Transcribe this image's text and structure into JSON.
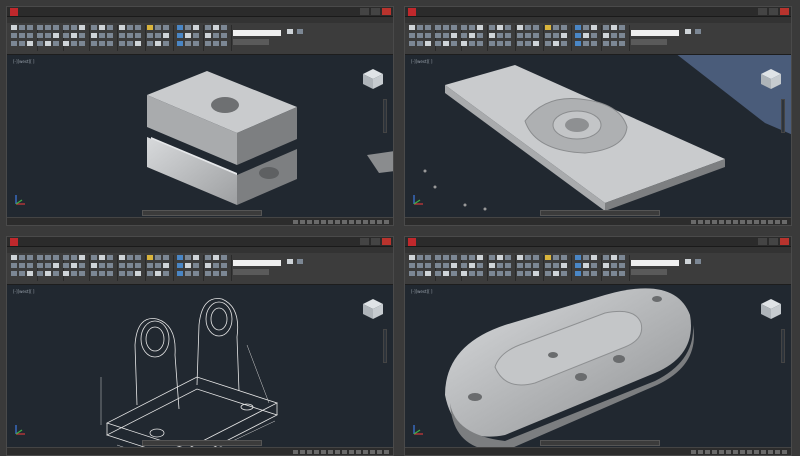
{
  "panes": [
    {
      "id": "p1",
      "model": "slotted-block"
    },
    {
      "id": "p2",
      "model": "plate-with-boss"
    },
    {
      "id": "p3",
      "model": "bearing-bracket-wireframe"
    },
    {
      "id": "p4",
      "model": "rounded-base-plate"
    }
  ],
  "colors": {
    "viewport_bg": "#212830",
    "ribbon_bg": "#3c3c3c",
    "solid_light": "#c9cbcd",
    "solid_mid": "#a9abad",
    "solid_dark": "#7d7f81",
    "wire": "#e6e6e6",
    "accent_red": "#c0282c"
  },
  "icons": [
    "autocad-logo-icon",
    "viewcube-icon",
    "ucs-axis-icon",
    "navigation-bar-icon"
  ]
}
